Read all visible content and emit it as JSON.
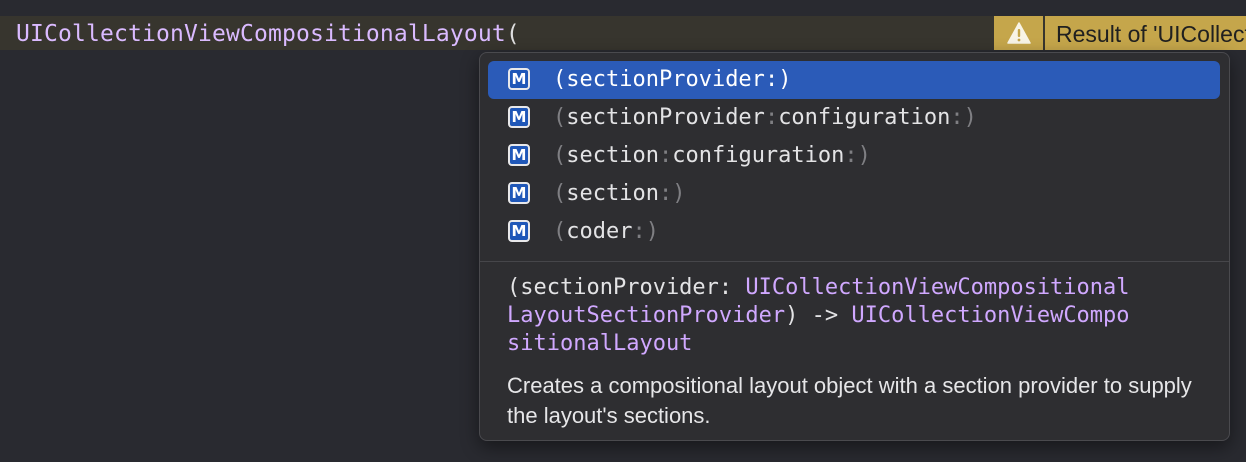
{
  "editor": {
    "code_text": "UICollectionViewCompositionalLayout",
    "code_paren": "("
  },
  "warning": {
    "icon": "warning-triangle-icon",
    "message": "Result of 'UICollectionViewCompositionalLayout' initializer is unused"
  },
  "completion": {
    "kind_badge": "M",
    "items": [
      {
        "open": "(",
        "parts": [
          {
            "name": "sectionProvider",
            "sep": ":"
          }
        ],
        "close": ")",
        "selected": true
      },
      {
        "open": "(",
        "parts": [
          {
            "name": "sectionProvider",
            "sep": ":"
          },
          {
            "name": "configuration",
            "sep": ":"
          }
        ],
        "close": ")",
        "selected": false
      },
      {
        "open": "(",
        "parts": [
          {
            "name": "section",
            "sep": ":"
          },
          {
            "name": "configuration",
            "sep": ":"
          }
        ],
        "close": ")",
        "selected": false
      },
      {
        "open": "(",
        "parts": [
          {
            "name": "section",
            "sep": ":"
          }
        ],
        "close": ")",
        "selected": false
      },
      {
        "open": "(",
        "parts": [
          {
            "name": "coder",
            "sep": ":"
          }
        ],
        "close": ")",
        "selected": false
      }
    ]
  },
  "detail": {
    "signature_lines": [
      [
        {
          "t": "(sectionProvider: ",
          "k": "plain"
        },
        {
          "t": "UICollectionViewCompositional",
          "k": "type"
        }
      ],
      [
        {
          "t": "LayoutSectionProvider",
          "k": "type"
        },
        {
          "t": ") -> ",
          "k": "plain"
        },
        {
          "t": "UICollectionViewCompo",
          "k": "type"
        }
      ],
      [
        {
          "t": "sitionalLayout",
          "k": "type"
        }
      ]
    ],
    "description": "Creates a compositional layout object with a section provider to supply the layout's sections."
  },
  "colors": {
    "background": "#292a30",
    "current_line": "#37352e",
    "warning": "#c5a64b",
    "selection": "#2b5bb8",
    "type_name": "#d0a8ff"
  }
}
